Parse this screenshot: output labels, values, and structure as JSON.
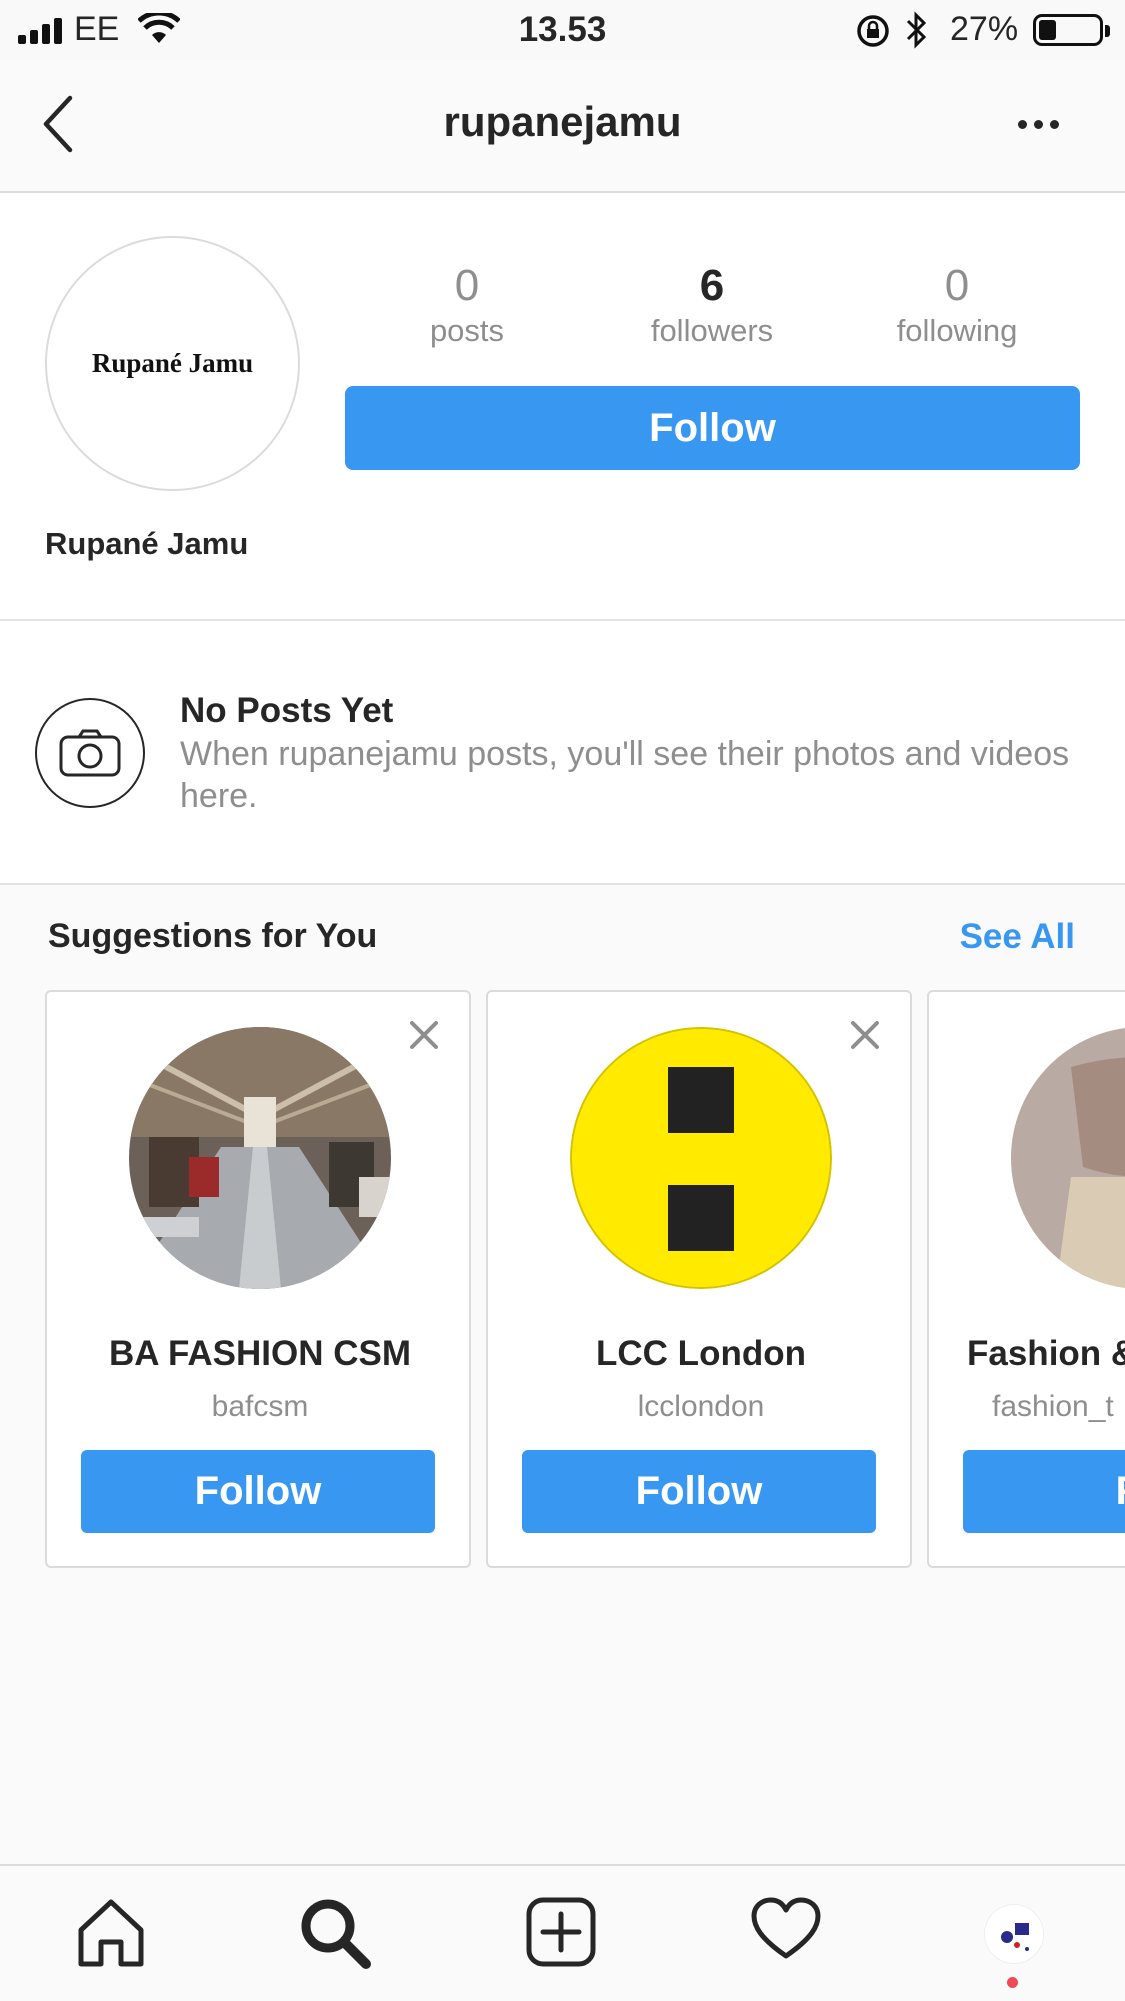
{
  "status_bar": {
    "carrier": "EE",
    "time": "13.53",
    "battery": "27%"
  },
  "header": {
    "username": "rupanejamu"
  },
  "profile": {
    "avatar_text": "Rupané Jamu",
    "display_name": "Rupané Jamu",
    "stats": [
      {
        "value": "0",
        "label": "posts"
      },
      {
        "value": "6",
        "label": "followers"
      },
      {
        "value": "0",
        "label": "following"
      }
    ],
    "follow_label": "Follow"
  },
  "no_posts": {
    "title": "No Posts Yet",
    "text": "When rupanejamu posts, you'll see their photos and videos here."
  },
  "suggestions": {
    "title": "Suggestions for You",
    "see_all": "See All",
    "cards": [
      {
        "name": "BA FASHION CSM",
        "handle": "bafcsm",
        "follow": "Follow"
      },
      {
        "name": "LCC London",
        "handle": "lcclondon",
        "follow": "Follow"
      },
      {
        "name": "Fashion &",
        "handle": "fashion_t",
        "follow": "Fo"
      }
    ]
  },
  "tabbar": {
    "icons": [
      "home-icon",
      "search-icon",
      "new-post-icon",
      "activity-heart-icon",
      "profile-avatar"
    ]
  },
  "colors": {
    "accent": "#3897f0",
    "text": "#262626",
    "muted": "#8e8e8e",
    "notification": "#ed4956",
    "yellow": "#ffea00"
  }
}
